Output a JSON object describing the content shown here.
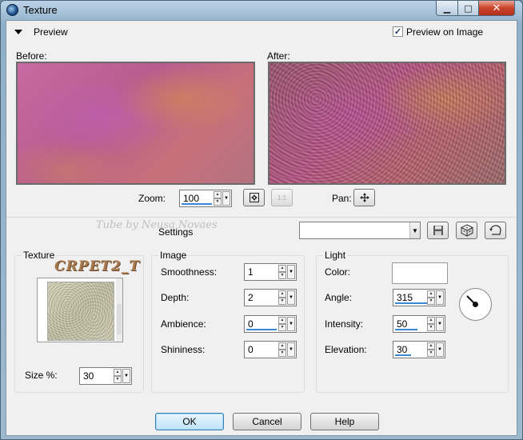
{
  "window": {
    "title": "Texture",
    "icons": {
      "app": "app-icon",
      "minimize": "minimize-icon",
      "maximize": "maximize-icon",
      "close": "close-icon"
    }
  },
  "preview": {
    "label": "Preview",
    "preview_on_image_label": "Preview on Image",
    "preview_on_image_checked": true,
    "before_label": "Before:",
    "after_label": "After:"
  },
  "zoom": {
    "label": "Zoom:",
    "value": "100",
    "fit_icon": "zoom-fit-icon",
    "one_to_one": "1:1"
  },
  "pan": {
    "label": "Pan:",
    "icon": "pan-icon"
  },
  "settings": {
    "label": "Settings",
    "watermark": "Tube by Neusa Novaes",
    "preset_value": "",
    "save_icon": "save-icon",
    "randomize_icon": "dice-icon",
    "reset_icon": "reset-icon"
  },
  "texture": {
    "title": "Texture",
    "name": "CRPET2_T",
    "size_label": "Size %:",
    "size_value": "30"
  },
  "image": {
    "title": "Image",
    "smoothness_label": "Smoothness:",
    "smoothness_value": "1",
    "depth_label": "Depth:",
    "depth_value": "2",
    "ambience_label": "Ambience:",
    "ambience_value": "0",
    "shininess_label": "Shininess:",
    "shininess_value": "0"
  },
  "light": {
    "title": "Light",
    "color_label": "Color:",
    "color_value": "#ffffff",
    "angle_label": "Angle:",
    "angle_value": "315",
    "intensity_label": "Intensity:",
    "intensity_value": "50",
    "elevation_label": "Elevation:",
    "elevation_value": "30"
  },
  "footer": {
    "ok": "OK",
    "cancel": "Cancel",
    "help": "Help"
  }
}
